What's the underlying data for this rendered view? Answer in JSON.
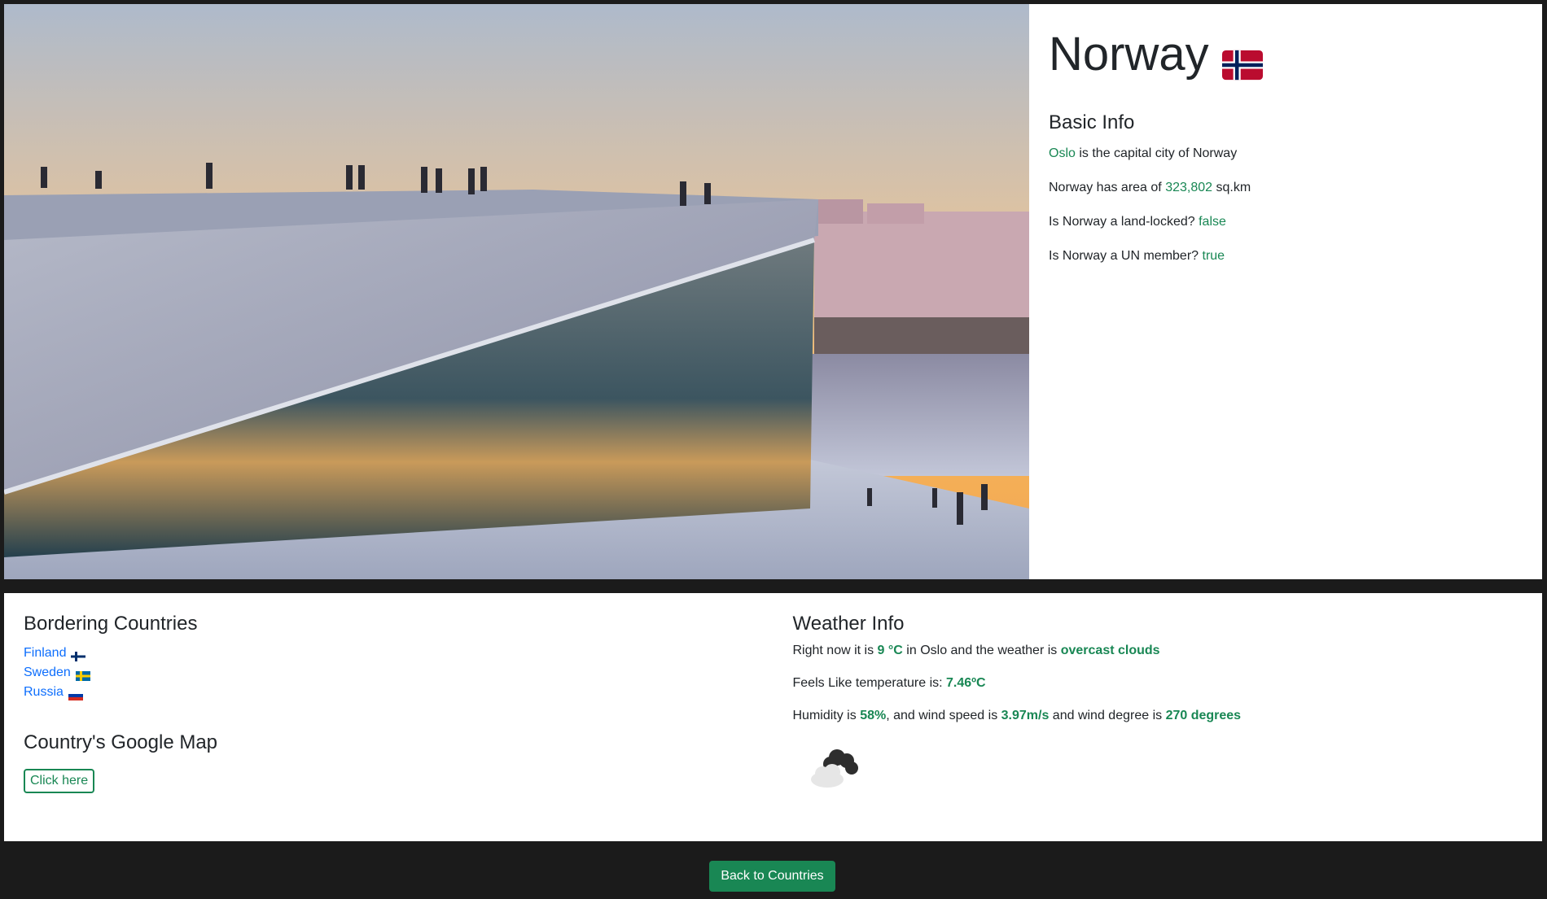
{
  "country": {
    "name": "Norway",
    "flag_icon": "norway-flag-icon"
  },
  "basic_info": {
    "heading": "Basic Info",
    "capital": "Oslo",
    "capital_text": " is the capital city of Norway",
    "area_prefix": "Norway has area of ",
    "area": "323,802",
    "area_suffix": " sq.km",
    "landlocked_prefix": "Is Norway a land-locked? ",
    "landlocked": "false",
    "un_prefix": "Is Norway a UN member? ",
    "un_member": "true"
  },
  "bordering": {
    "heading": "Bordering Countries",
    "countries": [
      {
        "name": "Finland",
        "flag_icon": "finland-flag-icon"
      },
      {
        "name": "Sweden",
        "flag_icon": "sweden-flag-icon"
      },
      {
        "name": "Russia",
        "flag_icon": "russia-flag-icon"
      }
    ]
  },
  "map": {
    "heading": "Country's Google Map",
    "button_label": "Click here"
  },
  "weather": {
    "heading": "Weather Info",
    "line1_prefix": "Right now it is ",
    "temp": "9 °C",
    "line1_mid": " in Oslo and the weather is ",
    "condition": "overcast clouds",
    "feels_prefix": "Feels Like temperature is: ",
    "feels": "7.46ºC",
    "humidity_prefix": "Humidity is ",
    "humidity": "58%",
    "wind_prefix": ", and wind speed is ",
    "wind_speed": "3.97m/s",
    "deg_prefix": " and wind degree is ",
    "wind_degree": "270 degrees",
    "icon": "overcast-clouds-icon"
  },
  "footer": {
    "back_label": "Back to Countries"
  },
  "colors": {
    "accent": "#198754",
    "link": "#0d6efd",
    "page_bg": "#1b1b1b"
  }
}
